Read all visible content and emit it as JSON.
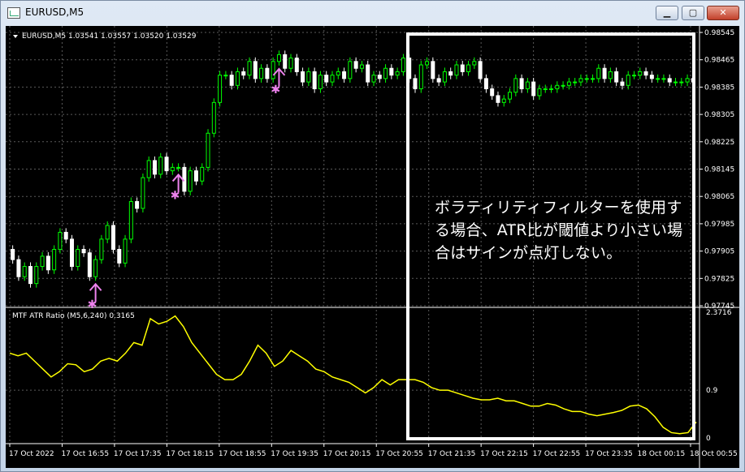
{
  "window": {
    "title": "EURUSD,M5",
    "minimize": "▁",
    "maximize": "▢",
    "close": "✕"
  },
  "price_info": "EURUSD,M5  1.03541 1.03557 1.03520 1.03529",
  "indicator_info": "MTF ATR Ratio  (M5,6,240) 0.3165",
  "annotation": "ボラティリティフィルターを使用する場合、ATR比が閾値より小さい場合はサインが点灯しない。",
  "chart_data": [
    {
      "type": "candlestick",
      "title": "EURUSD,M5",
      "ohlc_header": [
        1.03541,
        1.03557,
        1.0352,
        1.03529
      ],
      "ylim": [
        0.97745,
        0.98545
      ],
      "y_ticks": [
        "0.98545",
        "0.98465",
        "0.98385",
        "0.98305",
        "0.98225",
        "0.98145",
        "0.98065",
        "0.97985",
        "0.97905",
        "0.97825",
        "0.97745"
      ],
      "x_ticks": [
        "17 Oct 2022",
        "17 Oct 16:55",
        "17 Oct 17:35",
        "17 Oct 18:15",
        "17 Oct 18:55",
        "17 Oct 19:35",
        "17 Oct 20:15",
        "17 Oct 20:55",
        "17 Oct 21:35",
        "17 Oct 22:15",
        "17 Oct 22:55",
        "17 Oct 23:35",
        "18 Oct 00:15",
        "18 Oct 00:55"
      ],
      "bull_color": "#00ff00",
      "bear_color": "#ffffff",
      "bg": "#000000",
      "grid": true,
      "close": [
        0.9788,
        0.9783,
        0.9786,
        0.9781,
        0.9786,
        0.9789,
        0.9785,
        0.9791,
        0.9796,
        0.9794,
        0.9786,
        0.9791,
        0.979,
        0.9783,
        0.9788,
        0.9794,
        0.9798,
        0.9791,
        0.9787,
        0.9794,
        0.9805,
        0.9803,
        0.9812,
        0.9817,
        0.9813,
        0.9818,
        0.9814,
        0.9815,
        0.9815,
        0.9808,
        0.9814,
        0.9811,
        0.9815,
        0.9825,
        0.9834,
        0.9842,
        0.9842,
        0.9839,
        0.9843,
        0.9842,
        0.9846,
        0.9841,
        0.9844,
        0.9841,
        0.9846,
        0.9848,
        0.9844,
        0.9847,
        0.9843,
        0.984,
        0.9843,
        0.9838,
        0.9842,
        0.984,
        0.9842,
        0.9843,
        0.9841,
        0.9846,
        0.9844,
        0.9845,
        0.984,
        0.9842,
        0.9841,
        0.9844,
        0.9842,
        0.9843,
        0.9847,
        0.9841,
        0.9838,
        0.9845,
        0.9846,
        0.9841,
        0.984,
        0.9843,
        0.9842,
        0.9845,
        0.9843,
        0.9845,
        0.9846,
        0.9841,
        0.9838,
        0.9836,
        0.9834,
        0.9835,
        0.9837,
        0.9841,
        0.9838,
        0.984,
        0.9836,
        0.9838,
        0.9838,
        0.9838,
        0.9839,
        0.9839,
        0.984,
        0.984,
        0.9841,
        0.9841,
        0.9841,
        0.9844,
        0.9841,
        0.9843,
        0.984,
        0.9839,
        0.9842,
        0.9842,
        0.9843,
        0.9842,
        0.9841,
        0.9841,
        0.9841,
        0.984,
        0.984,
        0.984,
        0.9841,
        0.984
      ]
    },
    {
      "type": "line",
      "title": "MTF ATR Ratio",
      "params": "(M5,6,240)",
      "last_value": 0.3165,
      "ylim": [
        0,
        2.3716
      ],
      "y_ticks": [
        "2.3716",
        "0.9",
        "0"
      ],
      "level": 0.9,
      "color": "#ffff00",
      "values": [
        1.6,
        1.55,
        1.6,
        1.45,
        1.3,
        1.15,
        1.25,
        1.4,
        1.38,
        1.25,
        1.3,
        1.45,
        1.5,
        1.45,
        1.6,
        1.8,
        1.75,
        2.25,
        2.15,
        2.2,
        2.3,
        2.1,
        1.8,
        1.6,
        1.4,
        1.2,
        1.1,
        1.1,
        1.2,
        1.45,
        1.75,
        1.6,
        1.35,
        1.45,
        1.65,
        1.55,
        1.45,
        1.3,
        1.25,
        1.15,
        1.1,
        1.05,
        0.95,
        0.85,
        0.95,
        1.1,
        1.0,
        1.1,
        1.1,
        1.1,
        1.05,
        0.95,
        0.9,
        0.9,
        0.85,
        0.8,
        0.75,
        0.72,
        0.72,
        0.75,
        0.7,
        0.7,
        0.65,
        0.6,
        0.6,
        0.65,
        0.62,
        0.55,
        0.5,
        0.5,
        0.45,
        0.42,
        0.45,
        0.48,
        0.52,
        0.6,
        0.62,
        0.55,
        0.4,
        0.2,
        0.1,
        0.08,
        0.1,
        0.3
      ]
    }
  ],
  "signals": [
    {
      "kind": "buy-arrow",
      "color": "#ee82ee"
    },
    {
      "kind": "buy-arrow",
      "color": "#ee82ee"
    },
    {
      "kind": "buy-arrow",
      "color": "#ee82ee"
    }
  ]
}
